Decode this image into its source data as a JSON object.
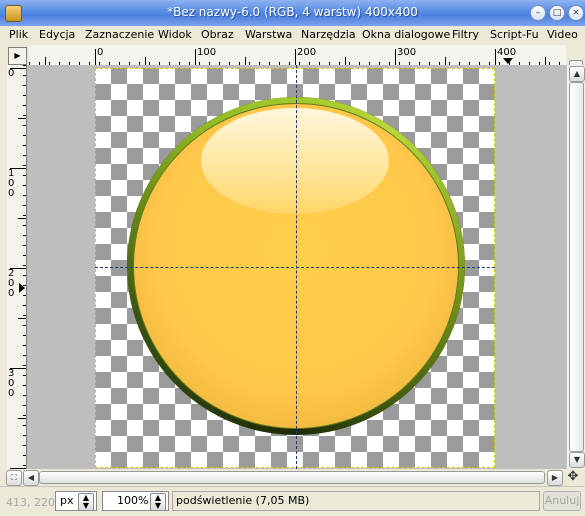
{
  "window": {
    "title": "*Bez nazwy-6.0 (RGB, 4 warstw) 400x400",
    "buttons": {
      "minimize": "–",
      "maximize": "□",
      "close": "×"
    }
  },
  "menubar": {
    "items": [
      {
        "label": "Plik"
      },
      {
        "label": "Edycja"
      },
      {
        "label": "Zaznaczenie"
      },
      {
        "label": "Widok"
      },
      {
        "label": "Obraz"
      },
      {
        "label": "Warstwa"
      },
      {
        "label": "Narzędzia"
      },
      {
        "label": "Okna dialogowe"
      },
      {
        "label": "Filtry"
      },
      {
        "label": "Script-Fu"
      },
      {
        "label": "Video"
      }
    ]
  },
  "rulers": {
    "horizontal_labels": [
      "0",
      "100",
      "200",
      "300",
      "400"
    ],
    "vertical_labels": [
      "0",
      "100",
      "200",
      "300"
    ]
  },
  "icons": {
    "app": "gimp-icon",
    "quick_mask": "quick-mask-icon",
    "nav": "navigate-icon",
    "zoom_fit": "zoom-to-fit-icon",
    "scroll_left": "arrow-left-icon",
    "scroll_right": "arrow-right-icon",
    "scroll_up": "arrow-up-icon",
    "scroll_down": "arrow-down-icon",
    "navigation": "navigation-cross-icon"
  },
  "statusbar": {
    "coordinates": "413, 220",
    "unit": "px",
    "zoom": "100%",
    "message": "podświetlenie (7,05 MB)",
    "cancel_label": "Anuluj"
  },
  "colors": {
    "titlebar": "#5c8fe8",
    "orb_fill": "#ffc84a",
    "orb_rim": "#3a5010",
    "guide": "#1a3a7a",
    "layer_boundary": "#e0c000"
  }
}
